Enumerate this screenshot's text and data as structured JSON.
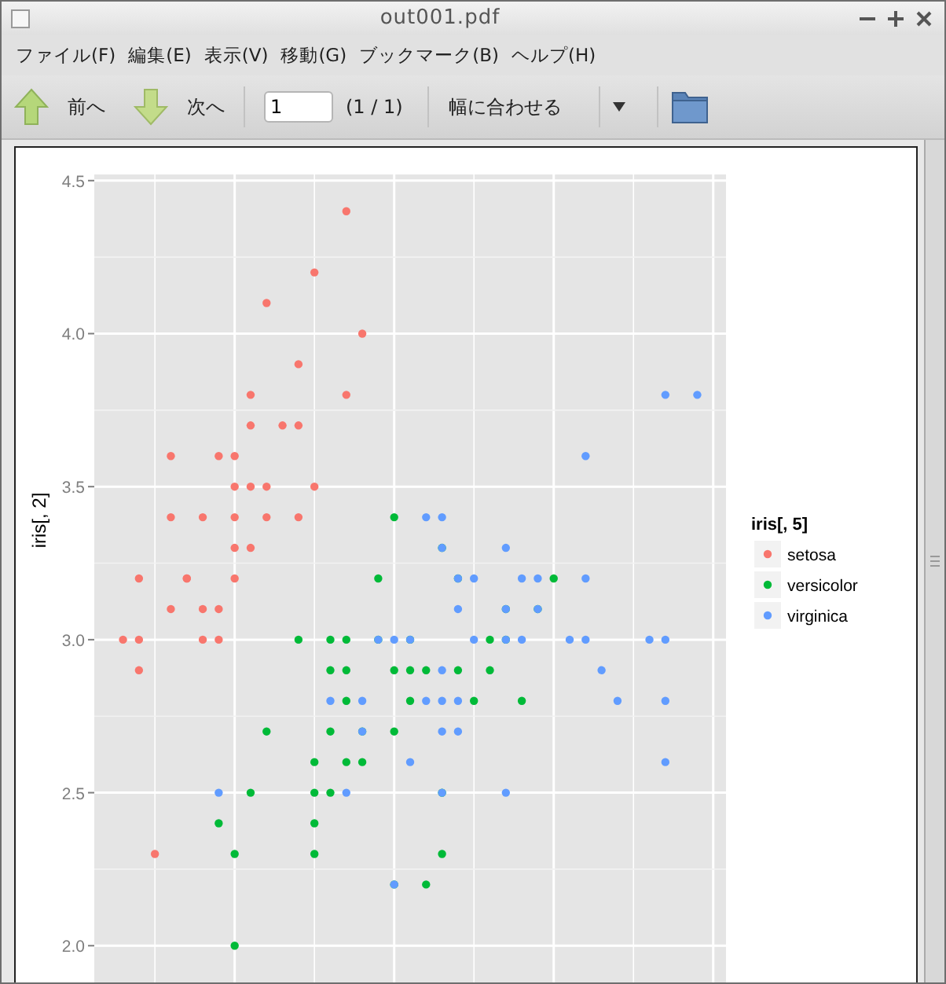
{
  "window": {
    "title": "out001.pdf"
  },
  "menu": [
    {
      "label": "ファイル(F)"
    },
    {
      "label": "編集(E)"
    },
    {
      "label": "表示(V)"
    },
    {
      "label": "移動(G)"
    },
    {
      "label": "ブックマーク(B)"
    },
    {
      "label": "ヘルプ(H)"
    }
  ],
  "toolbar": {
    "prev": {
      "label": "前へ"
    },
    "next": {
      "label": "次へ"
    },
    "page_field": {
      "value": "1"
    },
    "page_count": "(1 / 1)",
    "zoom": {
      "label": "幅に合わせる"
    }
  },
  "document": {
    "plot": {
      "ylabel": "iris[, 2]",
      "yticks": [
        "4.5",
        "4.0",
        "3.5",
        "3.0",
        "2.5",
        "2.0"
      ]
    },
    "legend": {
      "title": "iris[, 5]",
      "items": [
        {
          "label": "setosa",
          "color": "#f8766d"
        },
        {
          "label": "versicolor",
          "color": "#00ba38"
        },
        {
          "label": "virginica",
          "color": "#619cff"
        }
      ]
    }
  }
}
